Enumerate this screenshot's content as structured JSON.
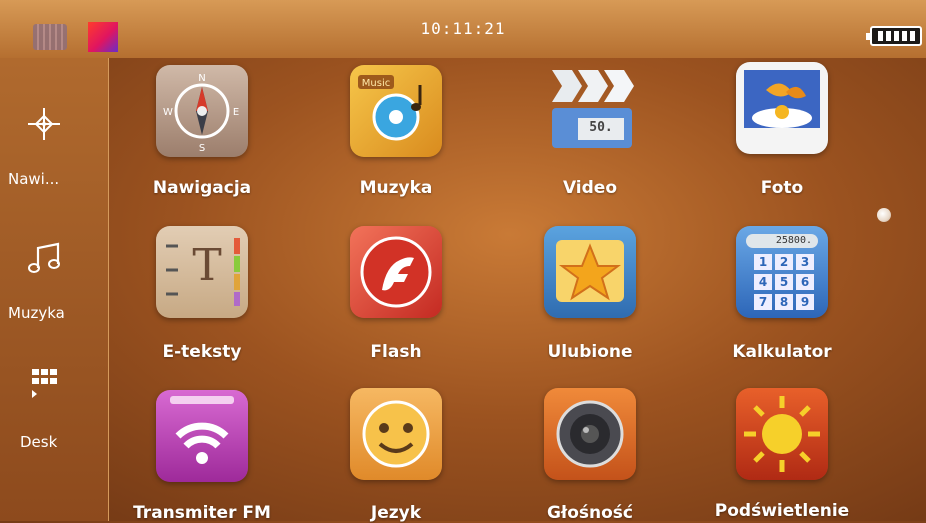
{
  "status_bar": {
    "time": "10:11:21"
  },
  "sidebar": {
    "items": [
      {
        "label": "Nawi...",
        "icon": "navigation-icon"
      },
      {
        "label": "Muzyka",
        "icon": "music-note-icon"
      },
      {
        "label": "Desk",
        "icon": "grid-icon"
      }
    ]
  },
  "apps": [
    {
      "label": "Nawigacja",
      "icon": "compass-icon"
    },
    {
      "label": "Muzyka",
      "icon": "music-icon"
    },
    {
      "label": "Video",
      "icon": "video-icon",
      "badge": "50."
    },
    {
      "label": "Foto",
      "icon": "photo-icon"
    },
    {
      "label": "E-teksty",
      "icon": "ebook-icon",
      "letter": "T"
    },
    {
      "label": "Flash",
      "icon": "flash-icon"
    },
    {
      "label": "Ulubione",
      "icon": "star-icon"
    },
    {
      "label": "Kalkulator",
      "icon": "calculator-icon",
      "display": "25800.",
      "keys": [
        "1",
        "2",
        "3",
        "4",
        "5",
        "6",
        "7",
        "8",
        "9"
      ]
    },
    {
      "label": "Transmiter FM",
      "icon": "fm-transmitter-icon"
    },
    {
      "label": "Jezyk",
      "icon": "smiley-icon"
    },
    {
      "label": "Głośność",
      "icon": "speaker-icon"
    },
    {
      "label": "Podświetlenie",
      "icon": "sun-icon"
    }
  ]
}
